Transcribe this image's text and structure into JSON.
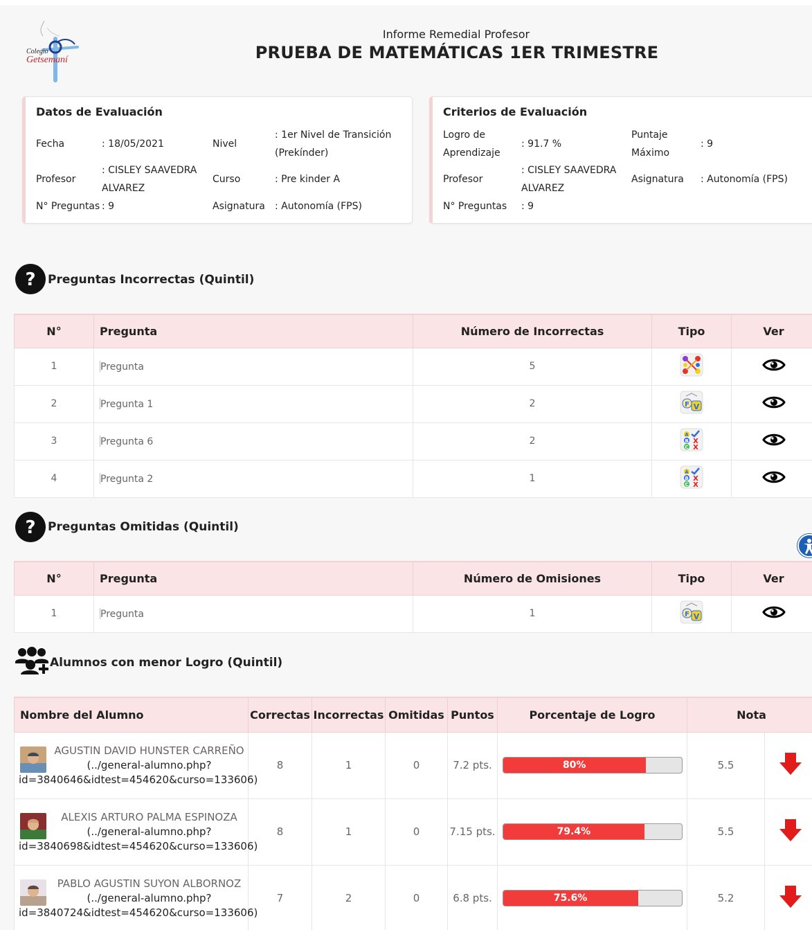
{
  "header": {
    "subtitle": "Informe Remedial Profesor",
    "title": "PRUEBA DE MATEMÁTICAS 1ER TRIMESTRE",
    "logo_line1": "Colegio",
    "logo_line2": "Getsemaní"
  },
  "datos": {
    "title": "Datos de Evaluación",
    "fecha_label": "Fecha",
    "fecha_value": ": 18/05/2021",
    "nivel_label": "Nivel",
    "nivel_value_1": ": 1er Nivel de Transición",
    "nivel_value_2": "(Prekínder)",
    "profesor_label": "Profesor",
    "profesor_value_1": ": CISLEY SAAVEDRA",
    "profesor_value_2": "ALVAREZ",
    "curso_label": "Curso",
    "curso_value": ": Pre kinder A",
    "preguntas_label": "N° Preguntas",
    "preguntas_value": ": 9",
    "asignatura_label": "Asignatura",
    "asignatura_value": ": Autonomía (FPS)"
  },
  "criterios": {
    "title": "Criterios de Evaluación",
    "logro_label_1": "Logro de",
    "logro_label_2": "Aprendizaje",
    "logro_value": ": 91.7 %",
    "puntaje_label_1": "Puntaje",
    "puntaje_label_2": "Máximo",
    "puntaje_value": ": 9",
    "profesor_label": "Profesor",
    "profesor_value_1": ": CISLEY SAAVEDRA",
    "profesor_value_2": "ALVAREZ",
    "asignatura_label": "Asignatura",
    "asignatura_value": ": Autonomía (FPS)",
    "preguntas_label": "N° Preguntas",
    "preguntas_value": ": 9"
  },
  "incorrectas": {
    "title": "Preguntas Incorrectas (Quintil)",
    "headers": [
      "N°",
      "Pregunta",
      "Número de Incorrectas",
      "Tipo",
      "Ver"
    ],
    "rows": [
      {
        "n": "1",
        "pregunta": "Pregunta",
        "count": "5",
        "tipo_icon": "matching-icon"
      },
      {
        "n": "2",
        "pregunta": "Pregunta 1",
        "count": "2",
        "tipo_icon": "true-false-icon"
      },
      {
        "n": "3",
        "pregunta": "Pregunta 6",
        "count": "2",
        "tipo_icon": "multiple-choice-icon"
      },
      {
        "n": "4",
        "pregunta": "Pregunta 2",
        "count": "1",
        "tipo_icon": "multiple-choice-icon"
      }
    ]
  },
  "omitidas": {
    "title": "Preguntas Omitidas (Quintil)",
    "headers": [
      "N°",
      "Pregunta",
      "Número de Omisiones",
      "Tipo",
      "Ver"
    ],
    "rows": [
      {
        "n": "1",
        "pregunta": "Pregunta",
        "count": "1",
        "tipo_icon": "true-false-icon"
      }
    ]
  },
  "alumnos": {
    "title": "Alumnos con menor Logro (Quintil)",
    "headers": [
      "Nombre del Alumno",
      "Correctas",
      "Incorrectas",
      "Omitidas",
      "Puntos",
      "Porcentaje de Logro",
      "Nota"
    ],
    "rows": [
      {
        "name": "AGUSTIN DAVID HUNSTER CARREÑO",
        "link_1": "(../general-alumno.php?",
        "link_2": "id=3840646&idtest=454620&curso=133606)",
        "correctas": "8",
        "incorrectas": "1",
        "omitidas": "0",
        "puntos": "7.2 pts.",
        "porcentaje": 80,
        "porcentaje_label": "80%",
        "nota": "5.5"
      },
      {
        "name": "ALEXIS ARTURO PALMA ESPINOZA",
        "link_1": "(../general-alumno.php?",
        "link_2": "id=3840698&idtest=454620&curso=133606)",
        "correctas": "8",
        "incorrectas": "1",
        "omitidas": "0",
        "puntos": "7.15 pts.",
        "porcentaje": 79.4,
        "porcentaje_label": "79.4%",
        "nota": "5.5"
      },
      {
        "name": "PABLO AGUSTIN SUYON ALBORNOZ",
        "link_1": "(../general-alumno.php?",
        "link_2": "id=3840724&idtest=454620&curso=133606)",
        "correctas": "7",
        "incorrectas": "2",
        "omitidas": "0",
        "puntos": "6.8 pts.",
        "porcentaje": 75.6,
        "porcentaje_label": "75.6%",
        "nota": "5.2"
      }
    ]
  },
  "colors": {
    "header_bg": "#fbe4e6",
    "progress_fill": "#f23c3c",
    "down_arrow": "#e21b1b",
    "accessibility": "#1d5fb4"
  }
}
